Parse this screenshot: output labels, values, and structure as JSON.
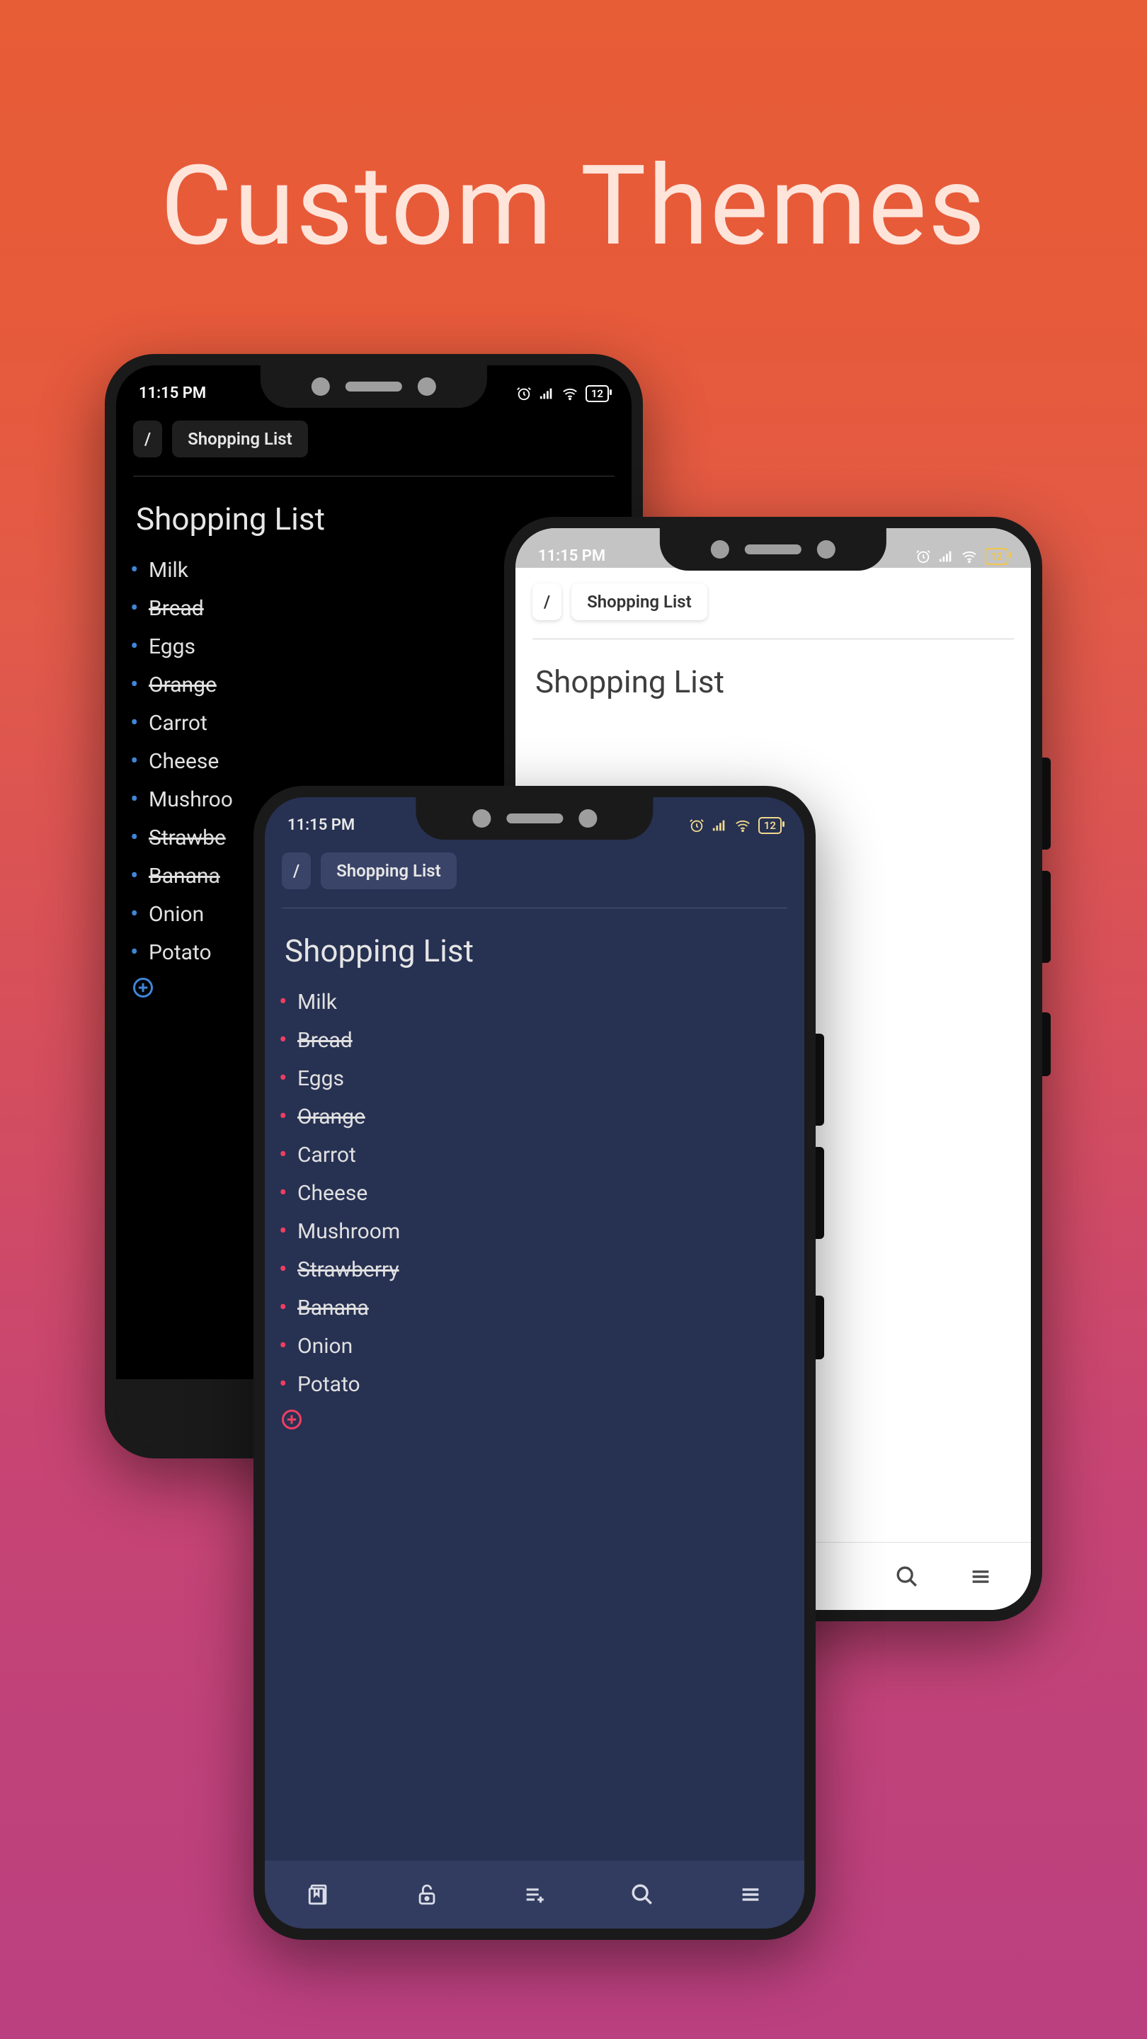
{
  "hero_title": "Custom Themes",
  "status_time": "11:15 PM",
  "battery": "12",
  "breadcrumb_root": "/",
  "breadcrumb_page": "Shopping List",
  "page_title": "Shopping List",
  "items": [
    {
      "label": "Milk",
      "done": false
    },
    {
      "label": "Bread",
      "done": true
    },
    {
      "label": "Eggs",
      "done": false
    },
    {
      "label": "Orange",
      "done": true
    },
    {
      "label": "Carrot",
      "done": false
    },
    {
      "label": "Cheese",
      "done": false
    },
    {
      "label": "Mushroom",
      "done": false
    },
    {
      "label": "Strawberry",
      "done": true
    },
    {
      "label": "Banana",
      "done": true
    },
    {
      "label": "Onion",
      "done": false
    },
    {
      "label": "Potato",
      "done": false
    }
  ],
  "dark_items_truncated": [
    {
      "label": "Milk",
      "done": false
    },
    {
      "label": "Bread",
      "done": true
    },
    {
      "label": "Eggs",
      "done": false
    },
    {
      "label": "Orange",
      "done": true
    },
    {
      "label": "Carrot",
      "done": false
    },
    {
      "label": "Cheese",
      "done": false
    },
    {
      "label": "Mushroo",
      "done": false
    },
    {
      "label": "Strawbe",
      "done": true
    },
    {
      "label": "Banana",
      "done": true
    },
    {
      "label": "Onion",
      "done": false
    },
    {
      "label": "Potato",
      "done": false
    }
  ],
  "nav": {
    "book": "book-icon",
    "lock": "lock-icon",
    "addlist": "add-list-icon",
    "search": "search-icon",
    "menu": "menu-icon"
  }
}
